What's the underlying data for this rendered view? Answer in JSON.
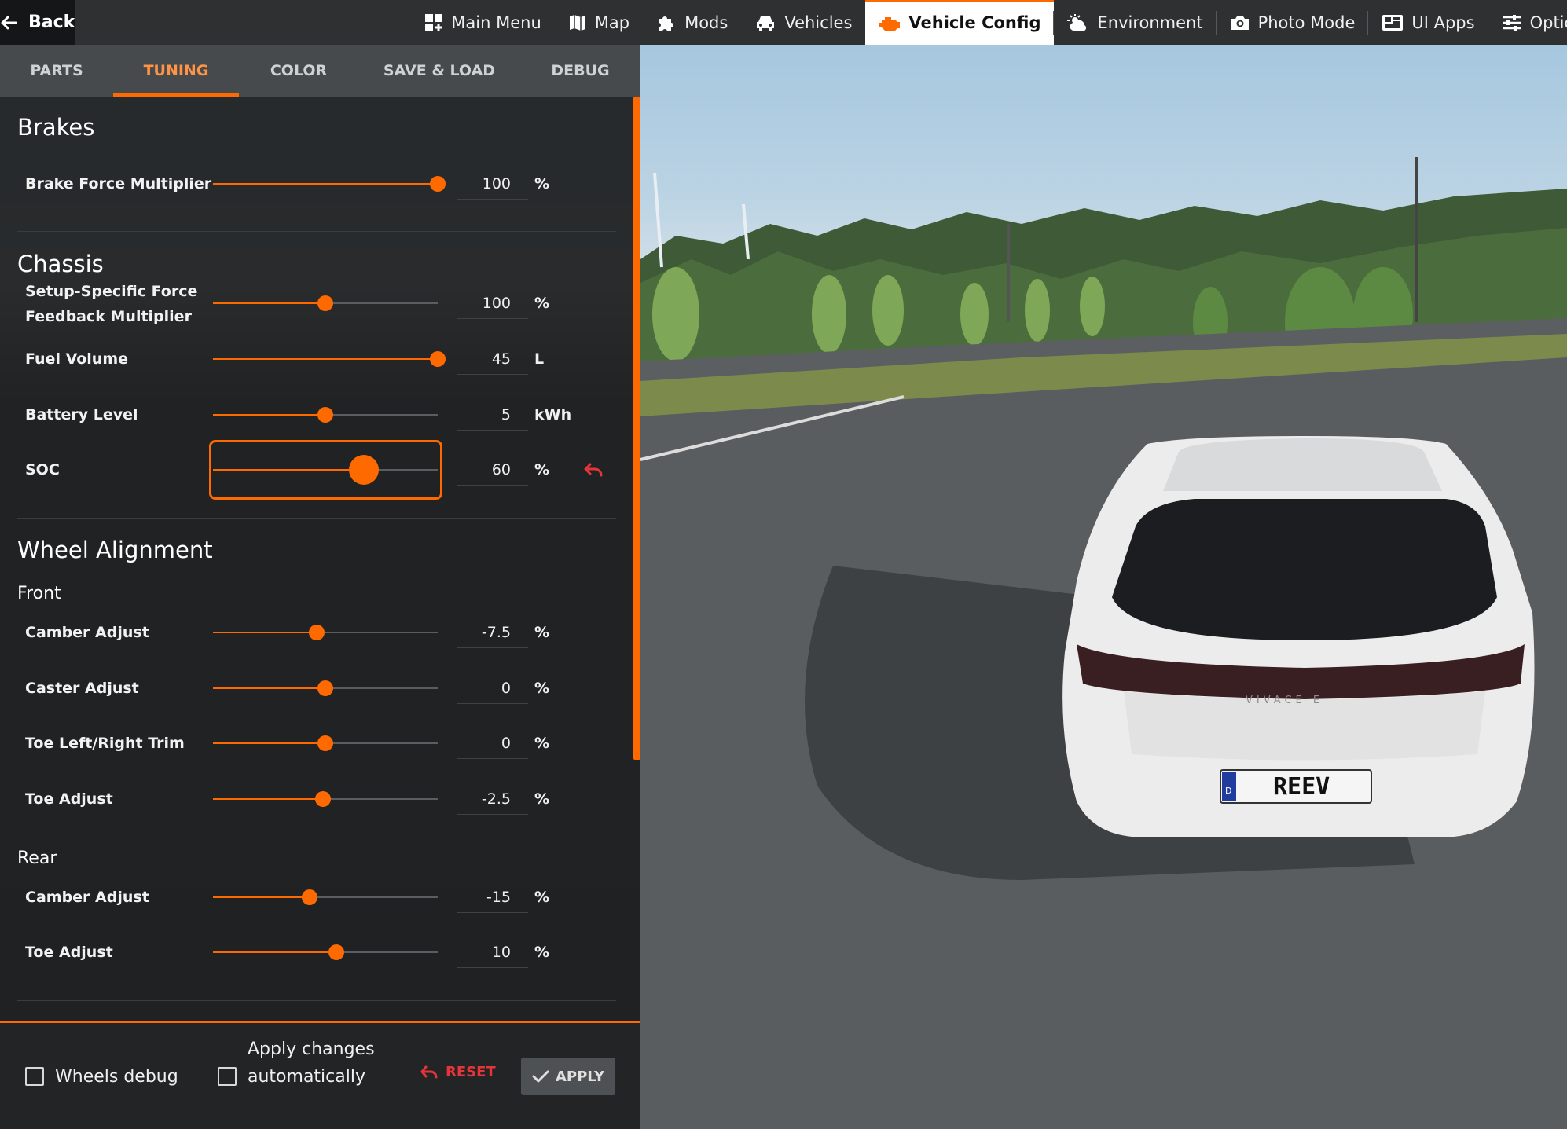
{
  "topbar": {
    "back_label": "Back",
    "items": [
      {
        "label": "Main Menu",
        "icon": "grid-icon"
      },
      {
        "label": "Map",
        "icon": "map-icon"
      },
      {
        "label": "Mods",
        "icon": "puzzle-icon"
      },
      {
        "label": "Vehicles",
        "icon": "car-icon"
      },
      {
        "label": "Vehicle Config",
        "icon": "engine-icon",
        "active": true
      },
      {
        "label": "Environment",
        "icon": "weather-icon"
      },
      {
        "label": "Photo Mode",
        "icon": "camera-icon"
      },
      {
        "label": "UI Apps",
        "icon": "apps-icon"
      },
      {
        "label": "Options",
        "icon": "sliders-icon"
      }
    ]
  },
  "tabs": [
    {
      "label": "PARTS"
    },
    {
      "label": "TUNING",
      "active": true
    },
    {
      "label": "COLOR"
    },
    {
      "label": "SAVE & LOAD"
    },
    {
      "label": "DEBUG"
    }
  ],
  "sections": {
    "brakes": "Brakes",
    "chassis": "Chassis",
    "wheel_alignment": "Wheel Alignment",
    "front": "Front",
    "rear": "Rear"
  },
  "settings": {
    "brake_force": {
      "label": "Brake Force Multiplier",
      "value": "100",
      "unit": "%",
      "fraction": 1.0
    },
    "ffb": {
      "label_line1": "Setup-Specific Force",
      "label_line2": "Feedback Multiplier",
      "value": "100",
      "unit": "%",
      "fraction": 0.5
    },
    "fuel_volume": {
      "label": "Fuel Volume",
      "value": "45",
      "unit": "L",
      "fraction": 1.0
    },
    "battery_level": {
      "label": "Battery Level",
      "value": "5",
      "unit": "kWh",
      "fraction": 0.5
    },
    "soc": {
      "label": "SOC",
      "value": "60",
      "unit": "%",
      "fraction": 0.67
    },
    "front_camber": {
      "label": "Camber Adjust",
      "value": "-7.5",
      "unit": "%",
      "fraction": 0.46
    },
    "front_caster": {
      "label": "Caster Adjust",
      "value": "0",
      "unit": "%",
      "fraction": 0.5
    },
    "front_toe_trim": {
      "label": "Toe Left/Right Trim",
      "value": "0",
      "unit": "%",
      "fraction": 0.5
    },
    "front_toe": {
      "label": "Toe Adjust",
      "value": "-2.5",
      "unit": "%",
      "fraction": 0.49
    },
    "rear_camber": {
      "label": "Camber Adjust",
      "value": "-15",
      "unit": "%",
      "fraction": 0.43
    },
    "rear_toe": {
      "label": "Toe Adjust",
      "value": "10",
      "unit": "%",
      "fraction": 0.55
    }
  },
  "bottom": {
    "wheels_debug": "Wheels debug",
    "apply_auto_line1": "Apply changes",
    "apply_auto_line2": "automatically",
    "reset_label": "RESET",
    "apply_label": "APPLY"
  },
  "scene": {
    "plate_text": "REEV",
    "plate_country": "D",
    "car_badge": "VIVACE E"
  },
  "colors": {
    "accent": "#ff6a00",
    "reset": "#e5353a",
    "panel_bg": "#1c1d1e"
  }
}
